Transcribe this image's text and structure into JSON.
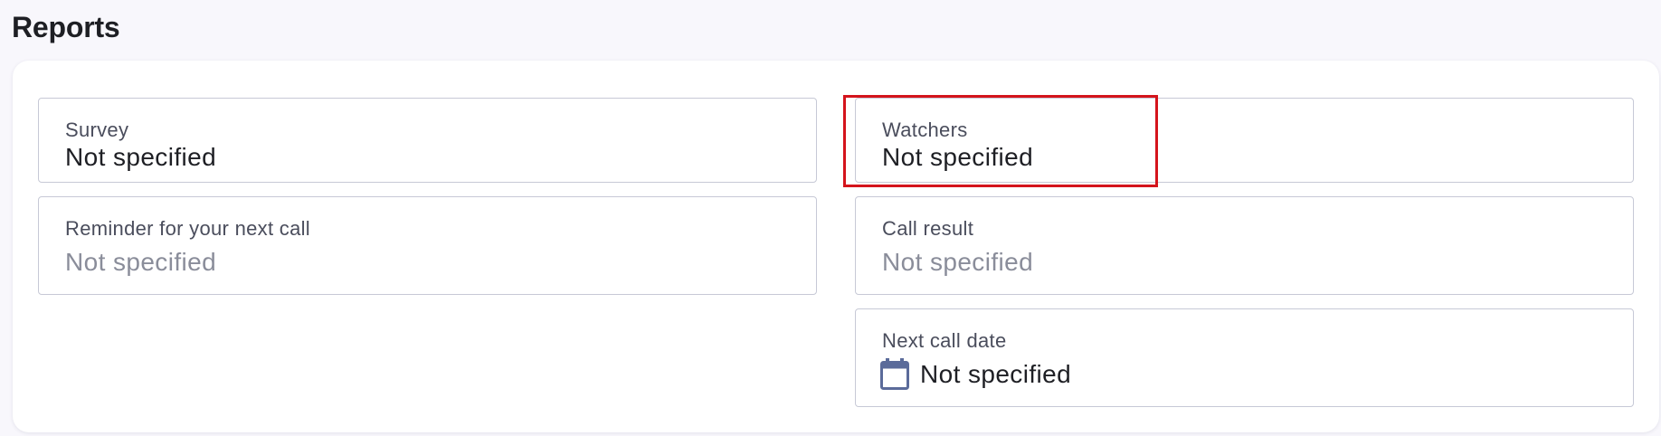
{
  "section": {
    "title": "Reports"
  },
  "fields": {
    "survey": {
      "label": "Survey",
      "value": "Not specified"
    },
    "watchers": {
      "label": "Watchers",
      "value": "Not specified"
    },
    "reminder": {
      "label": "Reminder for your next call",
      "value": "Not specified"
    },
    "call_result": {
      "label": "Call result",
      "value": "Not specified"
    },
    "next_call_date": {
      "label": "Next call date",
      "value": "Not specified",
      "icon": "calendar-icon"
    }
  },
  "colors": {
    "highlight": "#d4141c",
    "icon": "#5b6b9a",
    "placeholder_text": "#8a8d9a"
  }
}
